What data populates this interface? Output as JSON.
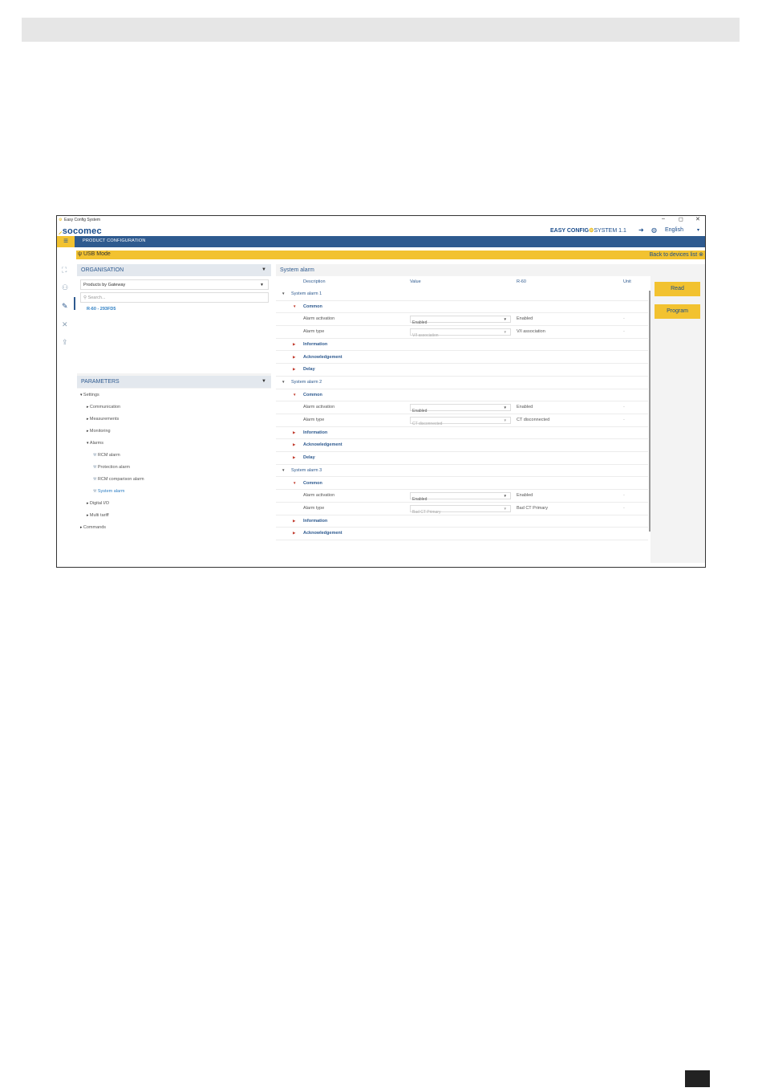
{
  "app": {
    "title": "Easy Config System",
    "logo": "socomec",
    "brand_bold": "EASY CONFIG",
    "brand_light": "SYSTEM 1.1",
    "language": "English",
    "nav_title": "PRODUCT CONFIGURATION",
    "usb_mode": "USB Mode",
    "back_link": "Back to devices list"
  },
  "organisation": {
    "title": "ORGANISATION",
    "dropdown": "Products by Gateway",
    "search_placeholder": "Search...",
    "device": "R-60 - 293FD5"
  },
  "parameters": {
    "title": "PARAMETERS",
    "tree": [
      {
        "label": "Settings",
        "level": 0,
        "expanded": true
      },
      {
        "label": "Communication",
        "level": 1
      },
      {
        "label": "Measurements",
        "level": 1
      },
      {
        "label": "Monitoring",
        "level": 1
      },
      {
        "label": "Alarms",
        "level": 1,
        "expanded": true
      },
      {
        "label": "RCM alarm",
        "level": 2
      },
      {
        "label": "Protection alarm",
        "level": 2
      },
      {
        "label": "RCM comparison alarm",
        "level": 2
      },
      {
        "label": "System alarm",
        "level": 2,
        "selected": true
      },
      {
        "label": "Digital I/O",
        "level": 1
      },
      {
        "label": "Multi tariff",
        "level": 1
      },
      {
        "label": "Commands",
        "level": 0
      }
    ]
  },
  "content": {
    "title": "System alarm",
    "columns": {
      "description": "Description",
      "value": "Value",
      "device": "R-60",
      "unit": "Unit"
    },
    "read_label": "Read",
    "program_label": "Program",
    "rows": [
      {
        "kind": "group",
        "label": "System alarm 1"
      },
      {
        "kind": "section",
        "label": "Common",
        "open": true
      },
      {
        "kind": "param",
        "label": "Alarm activation",
        "value": "Enabled",
        "device": "Enabled",
        "unit": "-",
        "enabled": true
      },
      {
        "kind": "param",
        "label": "Alarm type",
        "value": "V/I association",
        "device": "V/I association",
        "unit": "-",
        "enabled": false
      },
      {
        "kind": "section",
        "label": "Information"
      },
      {
        "kind": "section",
        "label": "Acknowledgement"
      },
      {
        "kind": "section",
        "label": "Delay"
      },
      {
        "kind": "group",
        "label": "System alarm 2"
      },
      {
        "kind": "section",
        "label": "Common",
        "open": true
      },
      {
        "kind": "param",
        "label": "Alarm activation",
        "value": "Enabled",
        "device": "Enabled",
        "unit": "-",
        "enabled": true
      },
      {
        "kind": "param",
        "label": "Alarm type",
        "value": "CT disconnected",
        "device": "CT disconnected",
        "unit": "-",
        "enabled": false
      },
      {
        "kind": "section",
        "label": "Information"
      },
      {
        "kind": "section",
        "label": "Acknowledgement"
      },
      {
        "kind": "section",
        "label": "Delay"
      },
      {
        "kind": "group",
        "label": "System alarm 3"
      },
      {
        "kind": "section",
        "label": "Common",
        "open": true
      },
      {
        "kind": "param",
        "label": "Alarm activation",
        "value": "Enabled",
        "device": "Enabled",
        "unit": "-",
        "enabled": true
      },
      {
        "kind": "param",
        "label": "Alarm type",
        "value": "Bad CT Primary",
        "device": "Bad CT Primary",
        "unit": "-",
        "enabled": false
      },
      {
        "kind": "section",
        "label": "Information"
      },
      {
        "kind": "section",
        "label": "Acknowledgement"
      }
    ]
  }
}
